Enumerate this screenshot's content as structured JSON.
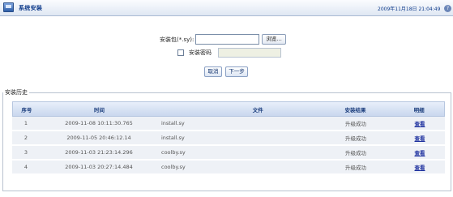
{
  "header": {
    "title": "系统安装",
    "datetime": "2009年11月18日 21:04:49",
    "help": "?"
  },
  "install_form": {
    "package_label": "安装包(*.sy):",
    "package_value": "",
    "browse_label": "浏览…",
    "password_label": "安装密码",
    "password_checked": false,
    "cancel_label": "取消",
    "next_label": "下一步"
  },
  "history": {
    "legend": "安装历史",
    "columns": [
      "序号",
      "时间",
      "文件",
      "安装结果",
      "明细"
    ],
    "rows": [
      {
        "no": "1",
        "time": "2009-11-08 10:11:30.765",
        "file": "install.sy",
        "result": "升级成功",
        "detail": "查看"
      },
      {
        "no": "2",
        "time": "2009-11-05 20:46:12.14",
        "file": "install.sy",
        "result": "升级成功",
        "detail": "查看"
      },
      {
        "no": "3",
        "time": "2009-11-03 21:23:14.296",
        "file": "coolby.sy",
        "result": "升级成功",
        "detail": "查看"
      },
      {
        "no": "4",
        "time": "2009-11-03 20:27:14.484",
        "file": "coolby.sy",
        "result": "升级成功",
        "detail": "查看"
      }
    ]
  }
}
